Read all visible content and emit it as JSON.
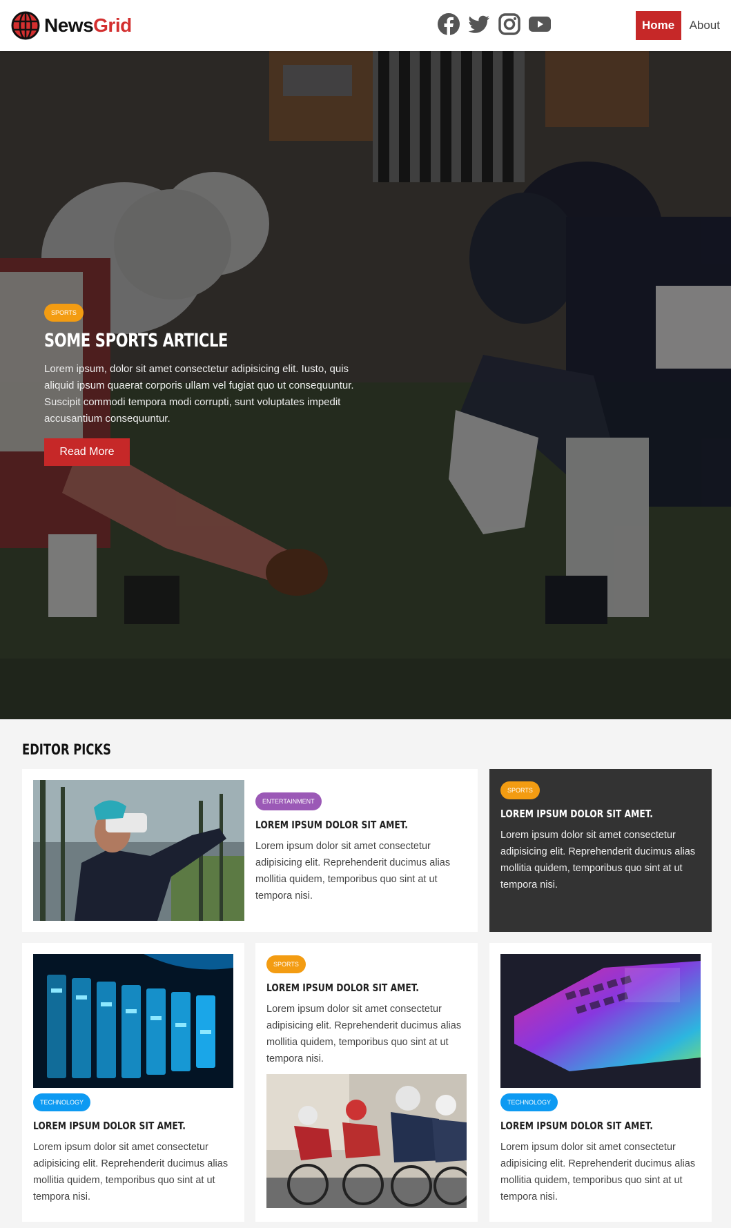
{
  "navbar": {
    "logo_text_1": "News",
    "logo_text_2": "Grid",
    "socials": [
      "facebook-icon",
      "twitter-icon",
      "instagram-icon",
      "youtube-icon"
    ],
    "home_label": "Home",
    "about_label": "About"
  },
  "hero": {
    "tag": "SPORTS",
    "title": "SOME SPORTS ARTICLE",
    "text": "Lorem ipsum, dolor sit amet consectetur adipisicing elit. Iusto, quis aliquid ipsum quaerat corporis ullam vel fugiat quo ut consequuntur. Suscipit commodi tempora modi corrupti, sunt voluptates impedit accusantium consequuntur.",
    "button_label": "Read More"
  },
  "editor_picks": {
    "heading": "EDITOR PICKS",
    "cards": [
      {
        "tag": "ENTERTAINMENT",
        "title": "LOREM IPSUM DOLOR SIT AMET.",
        "text": "Lorem ipsum dolor sit amet consectetur adipisicing elit. Reprehenderit ducimus alias mollitia quidem, temporibus quo sint at ut tempora nisi."
      },
      {
        "tag": "SPORTS",
        "title": "LOREM IPSUM DOLOR SIT AMET.",
        "text": "Lorem ipsum dolor sit amet consectetur adipisicing elit. Reprehenderit ducimus alias mollitia quidem, temporibus quo sint at ut tempora nisi."
      },
      {
        "tag": "TECHNOLOGY",
        "title": "LOREM IPSUM DOLOR SIT AMET.",
        "text": "Lorem ipsum dolor sit amet consectetur adipisicing elit. Reprehenderit ducimus alias mollitia quidem, temporibus quo sint at ut tempora nisi."
      },
      {
        "tag": "SPORTS",
        "title": "LOREM IPSUM DOLOR SIT AMET.",
        "text": "Lorem ipsum dolor sit amet consectetur adipisicing elit. Reprehenderit ducimus alias mollitia quidem, temporibus quo sint at ut tempora nisi."
      },
      {
        "tag": "TECHNOLOGY",
        "title": "LOREM IPSUM DOLOR SIT AMET.",
        "text": "Lorem ipsum dolor sit amet consectetur adipisicing elit. Reprehenderit ducimus alias mollitia quidem, temporibus quo sint at ut tempora nisi."
      }
    ]
  },
  "colors": {
    "brand_red": "#c62828",
    "sports_tag": "#f39c12",
    "entertainment_tag": "#9b59b6",
    "technology_tag": "#0d9af2",
    "dark_card": "#333333"
  }
}
